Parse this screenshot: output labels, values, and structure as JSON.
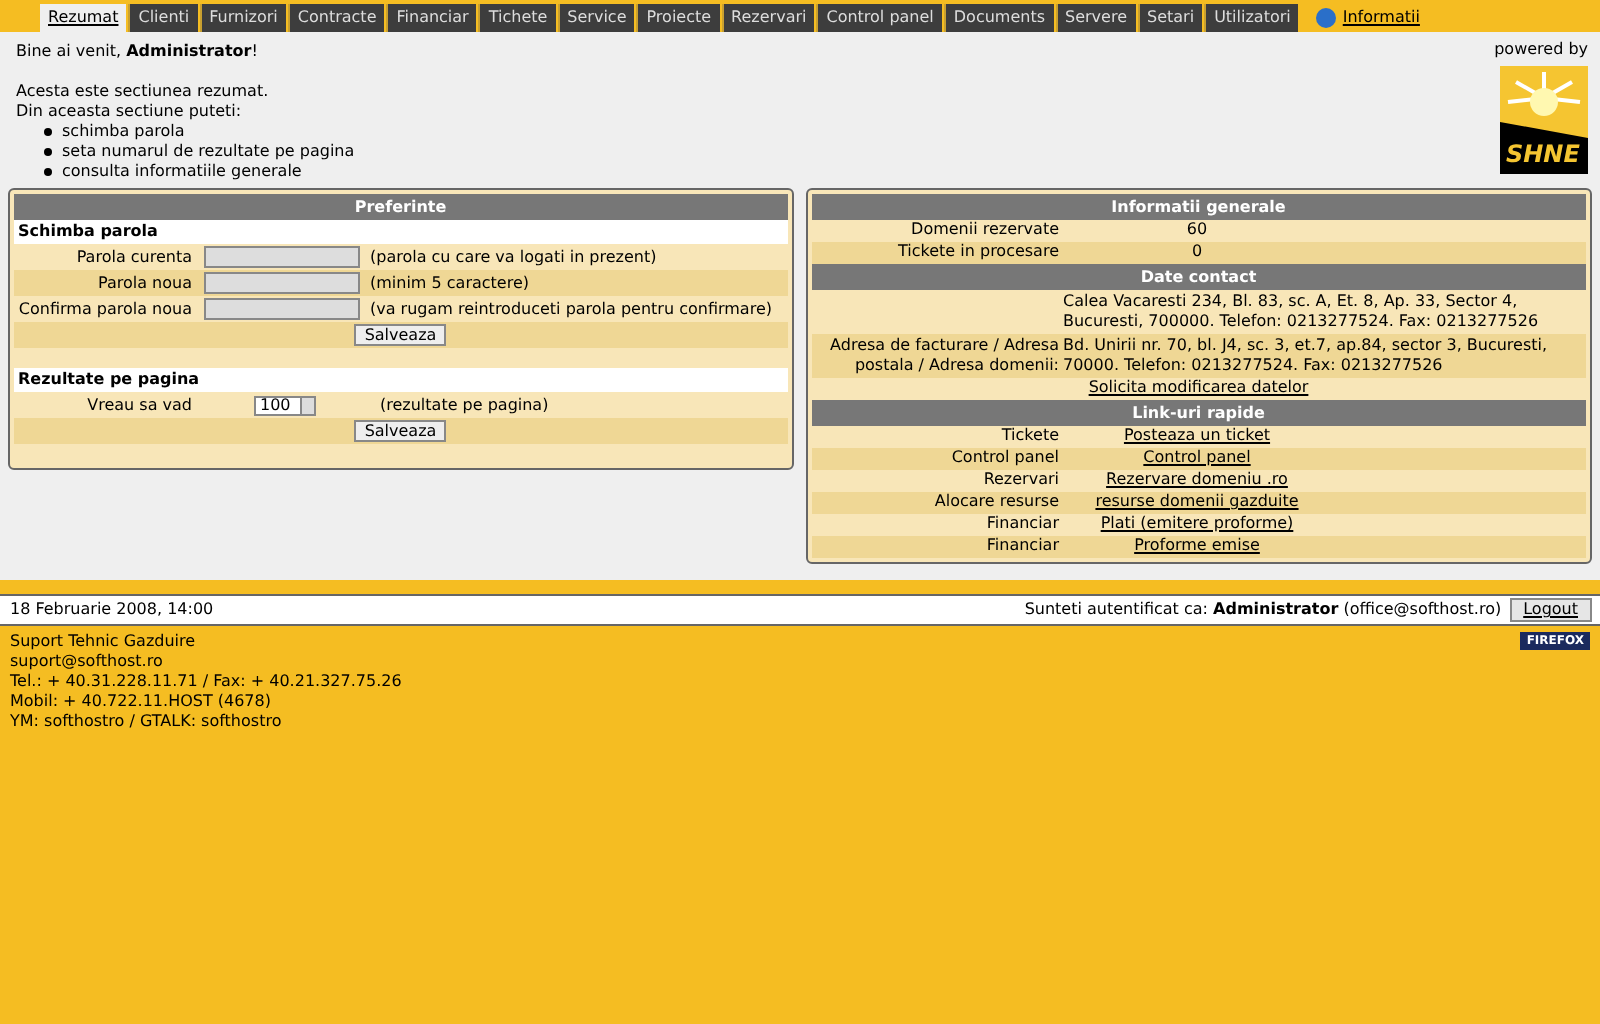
{
  "tabs": [
    {
      "label": "Rezumat",
      "selected": true
    },
    {
      "label": "Clienti",
      "selected": false
    },
    {
      "label": "Furnizori",
      "selected": false
    },
    {
      "label": "Contracte",
      "selected": false
    },
    {
      "label": "Financiar",
      "selected": false
    },
    {
      "label": "Tichete",
      "selected": false
    },
    {
      "label": "Service",
      "selected": false
    },
    {
      "label": "Proiecte",
      "selected": false
    },
    {
      "label": "Rezervari",
      "selected": false
    },
    {
      "label": "Control panel",
      "selected": false
    },
    {
      "label": "Documents",
      "selected": false
    },
    {
      "label": "Servere",
      "selected": false
    },
    {
      "label": "Setari",
      "selected": false
    },
    {
      "label": "Utilizatori",
      "selected": false
    }
  ],
  "info_link": "Informatii",
  "welcome": "Bine ai venit, **Administrator**!",
  "intro": [
    "Acesta este sectiunea rezumat.",
    "Din aceasta sectiune puteti:"
  ],
  "bullets": [
    "schimba parola",
    "seta numarul de rezultate pe pagina",
    "consulta informatiile generale"
  ],
  "powered_by": "powered by",
  "logo_text": "SHNE",
  "preferences": {
    "title": "Preferinte",
    "sections": [
      {
        "heading": "Schimba parola",
        "rows": [
          {
            "kind": "password",
            "label": "Parola curenta",
            "hint": "(parola cu care va logati in prezent)"
          },
          {
            "kind": "password",
            "label": "Parola noua",
            "hint": "(minim 5 caractere)"
          },
          {
            "kind": "password",
            "label": "Confirma parola noua",
            "hint": "(va rugam reintroduceti parola pentru confirmare)"
          }
        ],
        "button": "Salveaza"
      },
      {
        "heading": "Rezultate pe pagina",
        "rows": [
          {
            "kind": "select",
            "label": "Vreau sa vad",
            "value": "100",
            "hint": "(rezultate pe pagina)"
          }
        ],
        "button": "Salveaza"
      }
    ]
  },
  "general": {
    "title": "Informatii generale",
    "rows": [
      {
        "label": "Domenii rezervate",
        "value": "60"
      },
      {
        "label": "Tickete in procesare",
        "value": "0"
      }
    ]
  },
  "contact": {
    "title": "Date contact",
    "rows": [
      {
        "value": "Calea Vacaresti 234, Bl. 83, sc. A, Et. 8, Ap. 33, Sector 4, Bucuresti, 700000. Telefon: 0213277524. Fax: 0213277526"
      },
      {
        "label": "Adresa de facturare / Adresa postala / Adresa domenii:",
        "value": "Bd. Unirii nr. 70, bl. J4, sc. 3, et.7, ap.84, sector 3, Bucuresti, 70000. Telefon: 0213277524. Fax: 0213277526"
      }
    ],
    "link": "Solicita modificarea datelor"
  },
  "quick_links": {
    "title": "Link-uri rapide",
    "rows": [
      {
        "label": "Tickete",
        "link": "Posteaza un ticket"
      },
      {
        "label": "Control panel",
        "link": "Control panel"
      },
      {
        "label": "Rezervari",
        "link": "Rezervare domeniu .ro"
      },
      {
        "label": "Alocare resurse",
        "link": "resurse domenii gazduite"
      },
      {
        "label": "Financiar",
        "link": "Plati (emitere proforme)"
      },
      {
        "label": "Financiar",
        "link": "Proforme emise"
      }
    ]
  },
  "status_bar": {
    "date": "18 Februarie 2008, 14:00",
    "auth": "Sunteti autentificat ca: **Administrator** (office@softhost.ro)",
    "logout": "Logout"
  },
  "footer": [
    "Suport Tehnic Gazduire",
    "suport@softhost.ro",
    "Tel.: + 40.31.228.11.71 / Fax: + 40.21.327.75.26",
    "Mobil: + 40.722.11.HOST (4678)",
    "YM: softhostro / GTALK: softhostro"
  ],
  "badge": "FIREFOX"
}
